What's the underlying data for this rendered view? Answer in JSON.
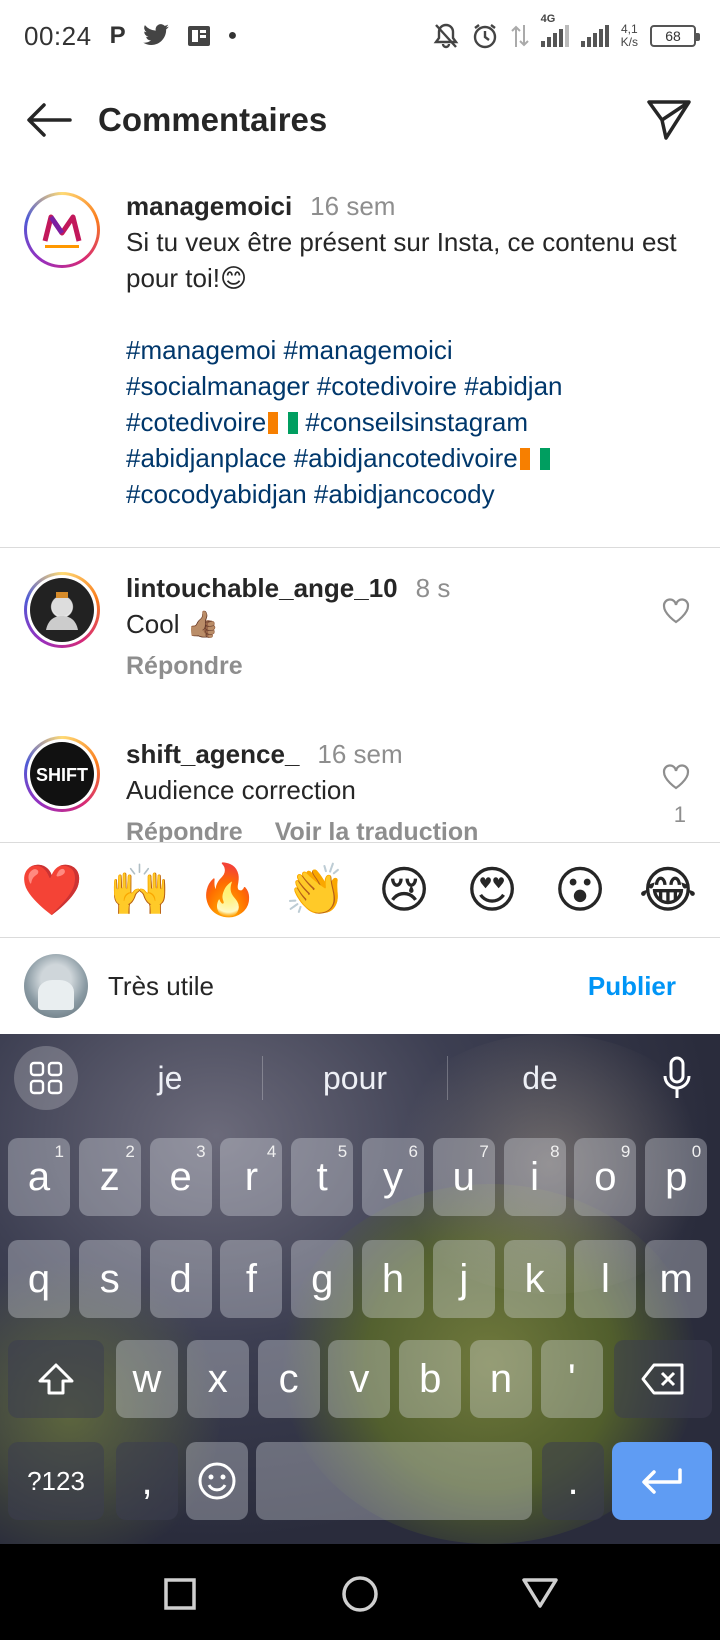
{
  "status_bar": {
    "time": "00:24",
    "network_type": "4G",
    "speed_value": "4,1",
    "speed_unit": "K/s",
    "battery": "68",
    "left_icons": [
      "p-app-icon",
      "twitter-icon",
      "news-icon",
      "dot-icon"
    ],
    "right_icons": [
      "mute-bell-icon",
      "alarm-icon",
      "data-arrows-icon",
      "signal-icon",
      "signal-icon-2",
      "battery-icon"
    ]
  },
  "header": {
    "title": "Commentaires"
  },
  "caption": {
    "username": "managemoici",
    "time": "16 sem",
    "text": "Si tu veux être présent sur Insta, ce contenu est pour toi!😊",
    "tags_line1": "#managemoi #managemoici",
    "tags_line2": "#socialmanager #cotedivoire #abidjan",
    "tags_line3": "#cotedivoire",
    "tags_line3b": " #conseilsinstagram",
    "tags_line4": "#abidjanplace #abidjancotedivoire",
    "tags_line5": "#cocodyabidjan #abidjancocody"
  },
  "comments": [
    {
      "username": "lintouchable_ange_10",
      "time": "8 s",
      "text": "Cool 👍🏽",
      "reply": "Répondre"
    },
    {
      "username": "shift_agence_",
      "time": "16 sem",
      "text": "Audience correction",
      "reply": "Répondre",
      "translate": "Voir la traduction",
      "likes": "1"
    }
  ],
  "emoji_bar": [
    "❤️",
    "🙌",
    "🔥",
    "👏",
    "😢",
    "😍",
    "😮",
    "😂"
  ],
  "composer": {
    "value": "Très utile",
    "publish": "Publier"
  },
  "keyboard": {
    "suggestions": [
      "je",
      "pour",
      "de"
    ],
    "row1": [
      "a",
      "z",
      "e",
      "r",
      "t",
      "y",
      "u",
      "i",
      "o",
      "p"
    ],
    "row1_hints": [
      "1",
      "2",
      "3",
      "4",
      "5",
      "6",
      "7",
      "8",
      "9",
      "0"
    ],
    "row2": [
      "q",
      "s",
      "d",
      "f",
      "g",
      "h",
      "j",
      "k",
      "l",
      "m"
    ],
    "row3": [
      "w",
      "x",
      "c",
      "v",
      "b",
      "n",
      "'"
    ],
    "symbols": "?123",
    "comma": ",",
    "period": "."
  },
  "colors": {
    "link": "#00376b",
    "publish": "#0095f6",
    "secondary_text": "#8e8e8e",
    "enter_key": "#5f9cf3"
  }
}
